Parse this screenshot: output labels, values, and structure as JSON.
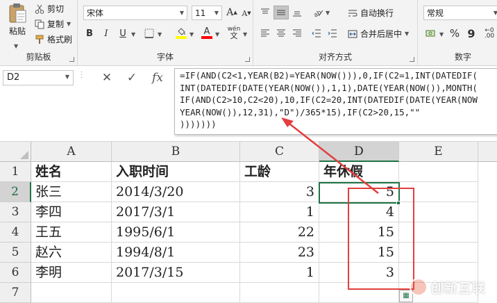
{
  "ribbon": {
    "clipboard": {
      "paste_label": "粘贴",
      "cut_label": "剪切",
      "copy_label": "复制",
      "format_painter_label": "格式刷",
      "group_label": "剪贴板"
    },
    "font": {
      "font_name": "宋体",
      "font_size": "11",
      "grow_label": "A",
      "shrink_label": "A",
      "bold_label": "B",
      "italic_label": "I",
      "underline_label": "U",
      "fill_color": "#ffff00",
      "font_color": "#ff0000",
      "font_color_label": "A",
      "phonetic_label": "wén",
      "group_label": "字体"
    },
    "alignment": {
      "wrap_label": "自动换行",
      "merge_label": "合并后居中",
      "group_label": "对齐方式"
    },
    "number": {
      "format_value": "常规",
      "percent_label": "%",
      "comma_label": "9",
      "group_label": "数字"
    }
  },
  "formula_bar": {
    "name_box": "D2",
    "cancel_label": "✕",
    "enter_label": "✓",
    "fx_label": "fx",
    "formula_lines": [
      "=IF(AND(C2<1,YEAR(B2)=YEAR(NOW())),0,IF(C2=1,INT(DATEDIF(",
      "INT(DATEDIF(DATE(YEAR(NOW()),1,1),DATE(YEAR(NOW()),MONTH(",
      "IF(AND(C2>10,C2<20),10,IF(C2=20,INT(DATEDIF(DATE(YEAR(NOW",
      "YEAR(NOW()),12,31),\"D\")/365*15),IF(C2>20,15,\"\"",
      ")))))))"
    ]
  },
  "sheet": {
    "columns": [
      "A",
      "B",
      "C",
      "D",
      "E"
    ],
    "row_numbers": [
      "1",
      "2",
      "3",
      "4",
      "5",
      "6",
      "7"
    ],
    "header_row": [
      "姓名",
      "入职时间",
      "工龄",
      "年休假"
    ],
    "rows": [
      [
        "张三",
        "2014/3/20",
        "3",
        "5"
      ],
      [
        "李四",
        "2017/3/1",
        "1",
        "4"
      ],
      [
        "王五",
        "1995/6/1",
        "22",
        "15"
      ],
      [
        "赵六",
        "1994/8/1",
        "23",
        "15"
      ],
      [
        "李明",
        "2017/3/15",
        "1",
        "3"
      ]
    ],
    "selected_cell": "D2",
    "accent_color": "#217346",
    "highlight_color": "#e33d3d"
  },
  "watermark": {
    "text": "创新互联"
  }
}
